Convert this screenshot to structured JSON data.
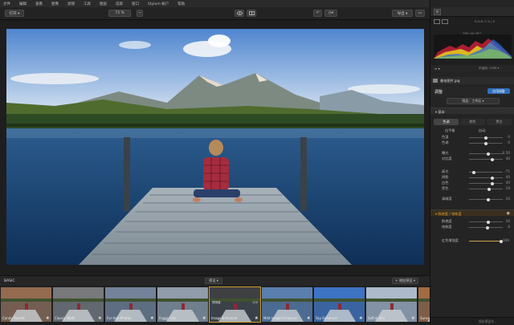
{
  "menubar": {
    "items": [
      "文件",
      "编辑",
      "查看",
      "图像",
      "滤镜",
      "工具",
      "图层",
      "选取",
      "窗口",
      "Stylum 帐户",
      "帮助"
    ]
  },
  "toolbar": {
    "open_label": "打开 ▾",
    "zoom_label": "73 %",
    "export_label": "导出 ▾"
  },
  "filmstrip_header": {
    "group_label": "BASIC",
    "category_label": "预设 ▾",
    "add_label": "+ 增加预设 ▾"
  },
  "presets": [
    {
      "label": "Candy Sunset",
      "tint": "#a07050",
      "selected": false
    },
    {
      "label": "Classic B&W",
      "tint": "#808080",
      "selected": false
    },
    {
      "label": "For Hue Photos",
      "tint": "#7a8aa0",
      "selected": false
    },
    {
      "label": "Foggy City",
      "tint": "#9aa6b4",
      "selected": false
    },
    {
      "label": "Image Enhancer",
      "tint": "#404040",
      "selected": true
    },
    {
      "label": "Mild Image Enhancer",
      "tint": "#5e86b8",
      "selected": false
    },
    {
      "label": "Sky Enhancer",
      "tint": "#3f7ad0",
      "selected": false
    },
    {
      "label": "Soft & Airy",
      "tint": "#b9c7d8",
      "selected": false
    },
    {
      "label": "Sunset",
      "tint": "#b07040",
      "selected": false
    }
  ],
  "selected_preset_overlay": {
    "mode": "透明度",
    "amount": "100"
  },
  "panel": {
    "top_tabs": [
      "⚙",
      "⚙"
    ],
    "histogram_info": "R:G:B: 0 % | 0",
    "histogram_sub": "光圈 1/60 快门",
    "hist_toolbar_left": "≡ ▾",
    "hist_toolbar_mid": "不适用: 1399 ▾",
    "layer_name": "美化图片.jpg",
    "adjust_title": "调整",
    "apply_button": "应用调整",
    "preset_title": "图层：工作区 ▾",
    "basic_section": "▾ 基本",
    "tone_tabs": [
      "色调",
      "颜色",
      "黑白"
    ],
    "wb_label": "白平衡",
    "wb_value": "自动",
    "sliders_group1": [
      {
        "label": "色温",
        "value": "0",
        "pos": 0.5
      },
      {
        "label": "色调",
        "value": "0",
        "pos": 0.5
      }
    ],
    "sliders_group2": [
      {
        "label": "曝光",
        "value": "0.50",
        "pos": 0.58
      },
      {
        "label": "对比度",
        "value": "40",
        "pos": 0.7
      }
    ],
    "sliders_group3": [
      {
        "label": "高光",
        "value": "-71",
        "pos": 0.15
      },
      {
        "label": "阴影",
        "value": "40",
        "pos": 0.7
      },
      {
        "label": "白色",
        "value": "40",
        "pos": 0.7
      },
      {
        "label": "黑色",
        "value": "19",
        "pos": 0.6
      }
    ],
    "sliders_group4": [
      {
        "label": "清晰度",
        "value": "16",
        "pos": 0.58
      }
    ],
    "vibrance_section": "▾ 鲜艳度 / 饱和度",
    "sliders_group5": [
      {
        "label": "鲜艳度",
        "value": "16",
        "pos": 0.58
      },
      {
        "label": "饱和度",
        "value": "8",
        "pos": 0.54
      }
    ],
    "opacity_label": "红色增强度",
    "opacity_value": "100",
    "status_text": "保存预设为..."
  },
  "colors": {
    "accent": "#2f6fbd",
    "selection": "#c99a2e",
    "vibrance_header": "#e0a030"
  }
}
